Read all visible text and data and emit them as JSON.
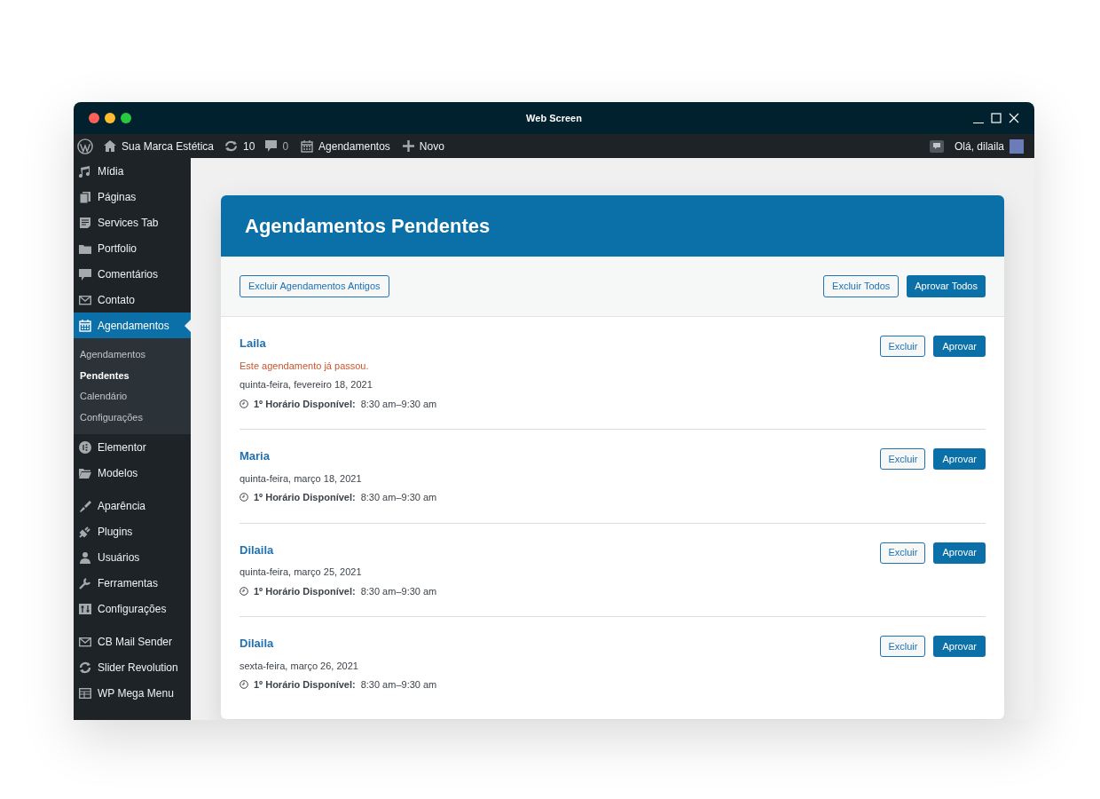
{
  "window": {
    "title": "Web Screen"
  },
  "admin_bar": {
    "site": "Sua Marca Estética",
    "updates": "10",
    "comments": "0",
    "menu": "Agendamentos",
    "new": "Novo",
    "greeting": "Olá, dilaila"
  },
  "sidebar": {
    "groups": [
      [
        {
          "label": "Mídia",
          "selected": false
        },
        {
          "label": "Páginas",
          "selected": false
        },
        {
          "label": "Services Tab",
          "selected": false
        },
        {
          "label": "Portfolio",
          "selected": false
        },
        {
          "label": "Comentários",
          "selected": false
        },
        {
          "label": "Contato",
          "selected": false
        },
        {
          "label": "Agendamentos",
          "selected": true,
          "children": [
            {
              "label": "Agendamentos",
              "selected": false
            },
            {
              "label": "Pendentes",
              "selected": true
            },
            {
              "label": "Calendário",
              "selected": false
            },
            {
              "label": "Configurações",
              "selected": false
            }
          ]
        },
        {
          "label": "Elementor",
          "selected": false
        },
        {
          "label": "Modelos",
          "selected": false
        }
      ],
      [
        {
          "label": "Aparência",
          "selected": false
        },
        {
          "label": "Plugins",
          "selected": false
        },
        {
          "label": "Usuários",
          "selected": false
        },
        {
          "label": "Ferramentas",
          "selected": false
        },
        {
          "label": "Configurações",
          "selected": false
        }
      ],
      [
        {
          "label": "CB Mail Sender",
          "selected": false
        },
        {
          "label": "Slider Revolution",
          "selected": false
        },
        {
          "label": "WP Mega Menu",
          "selected": false
        }
      ]
    ]
  },
  "panel": {
    "title": "Agendamentos Pendentes",
    "delete_old": "Excluir Agendamentos Antigos",
    "delete_all": "Excluir Todos",
    "approve_all": "Aprovar Todos",
    "appointments": [
      {
        "name": "Laila",
        "notice": "Este agendamento já passou.",
        "date": "quinta-feira, fevereiro 18, 2021",
        "slot_label": "1º Horário Disponível:",
        "slot_time": "8:30 am–9:30 am",
        "delete": "Excluir",
        "approve": "Aprovar"
      },
      {
        "name": "Maria",
        "date": "quinta-feira, março 18, 2021",
        "slot_label": "1º Horário Disponível:",
        "slot_time": "8:30 am–9:30 am",
        "delete": "Excluir",
        "approve": "Aprovar"
      },
      {
        "name": "Dilaila",
        "date": "quinta-feira, março 25, 2021",
        "slot_label": "1º Horário Disponível:",
        "slot_time": "8:30 am–9:30 am",
        "delete": "Excluir",
        "approve": "Aprovar"
      },
      {
        "name": "Dilaila",
        "date": "sexta-feira, março 26, 2021",
        "slot_label": "1º Horário Disponível:",
        "slot_time": "8:30 am–9:30 am",
        "delete": "Excluir",
        "approve": "Aprovar"
      }
    ]
  }
}
